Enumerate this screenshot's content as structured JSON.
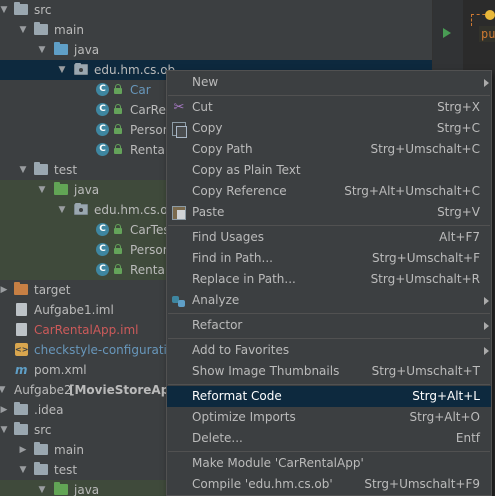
{
  "tree": {
    "rows": [
      {
        "label": "src"
      },
      {
        "label": "main"
      },
      {
        "label": "java"
      },
      {
        "label": "edu.hm.cs.ob"
      },
      {
        "label": "Car"
      },
      {
        "label": "CarRen"
      },
      {
        "label": "Person"
      },
      {
        "label": "RentalA"
      },
      {
        "label": "test"
      },
      {
        "label": "java"
      },
      {
        "label": "edu.hm.cs.ob"
      },
      {
        "label": "CarTest"
      },
      {
        "label": "Person"
      },
      {
        "label": "RentalA"
      },
      {
        "label": "target"
      },
      {
        "label": "Aufgabe1.iml"
      },
      {
        "label": "CarRentalApp.iml"
      },
      {
        "label": "checkstyle-configuration"
      },
      {
        "label": "pom.xml"
      },
      {
        "label": "Aufgabe2",
        "extra": "[MovieStoreApp]"
      },
      {
        "label": ".idea"
      },
      {
        "label": "src"
      },
      {
        "label": "main"
      },
      {
        "label": "test"
      },
      {
        "label": "java"
      }
    ]
  },
  "editor": {
    "snippet": "pub"
  },
  "menu": {
    "items": [
      {
        "label": "New",
        "shortcut": ""
      },
      {
        "label": "Cut",
        "shortcut": "Strg+X"
      },
      {
        "label": "Copy",
        "shortcut": "Strg+C"
      },
      {
        "label": "Copy Path",
        "shortcut": "Strg+Umschalt+C"
      },
      {
        "label": "Copy as Plain Text",
        "shortcut": ""
      },
      {
        "label": "Copy Reference",
        "shortcut": "Strg+Alt+Umschalt+C"
      },
      {
        "label": "Paste",
        "shortcut": "Strg+V"
      },
      {
        "label": "Find Usages",
        "shortcut": "Alt+F7"
      },
      {
        "label": "Find in Path...",
        "shortcut": "Strg+Umschalt+F"
      },
      {
        "label": "Replace in Path...",
        "shortcut": "Strg+Umschalt+R"
      },
      {
        "label": "Analyze",
        "shortcut": ""
      },
      {
        "label": "Refactor",
        "shortcut": ""
      },
      {
        "label": "Add to Favorites",
        "shortcut": ""
      },
      {
        "label": "Show Image Thumbnails",
        "shortcut": "Strg+Umschalt+T"
      },
      {
        "label": "Reformat Code",
        "shortcut": "Strg+Alt+L"
      },
      {
        "label": "Optimize Imports",
        "shortcut": "Strg+Alt+O"
      },
      {
        "label": "Delete...",
        "shortcut": "Entf"
      },
      {
        "label": "Make Module 'CarRentalApp'",
        "shortcut": ""
      },
      {
        "label": "Compile 'edu.hm.cs.ob'",
        "shortcut": "Strg+Umschalt+F9"
      }
    ]
  },
  "colors": {
    "background": "#3c3f41",
    "selection": "#0d293e",
    "test_background": "#3f4a3b",
    "menu_text": "#bbbbbb",
    "blue_text": "#6897bb",
    "red_text": "#cc5a5a"
  }
}
